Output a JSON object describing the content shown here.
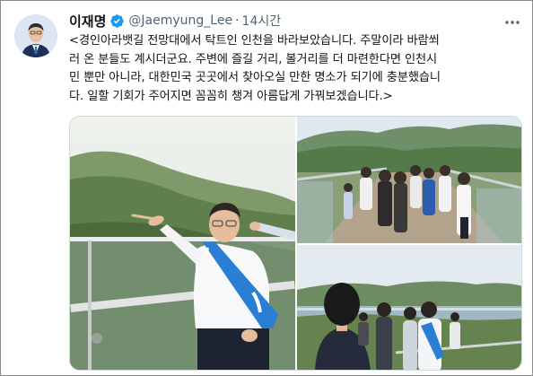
{
  "tweet": {
    "author_name": "이재명",
    "handle": "@Jaemyung_Lee",
    "separator": "·",
    "time": "14시간",
    "text_lines": [
      "<경인아라뱃길 전망대에서 탁트인 인천을 바라보았습니다. 주말이라 바람쐬",
      "러 온 분들도 계시더군요. 주변에 즐길 거리, 볼거리를 더 마련한다면 인천시",
      "민 뿐만 아니라, 대한민국 곳곳에서 찾아오실 만한 명소가 되기에 충분했습니",
      "다. 일할 기회가 주어지면 꼼꼼히 챙겨 아름답게 가꿔보겠습니다.>"
    ]
  },
  "icons": {
    "verified": "verified-badge-icon",
    "more": "more-options-icon"
  },
  "colors": {
    "verified_blue": "#1d9bf0",
    "secondary_text": "#536471",
    "sash_blue": "#2a7fd4"
  }
}
